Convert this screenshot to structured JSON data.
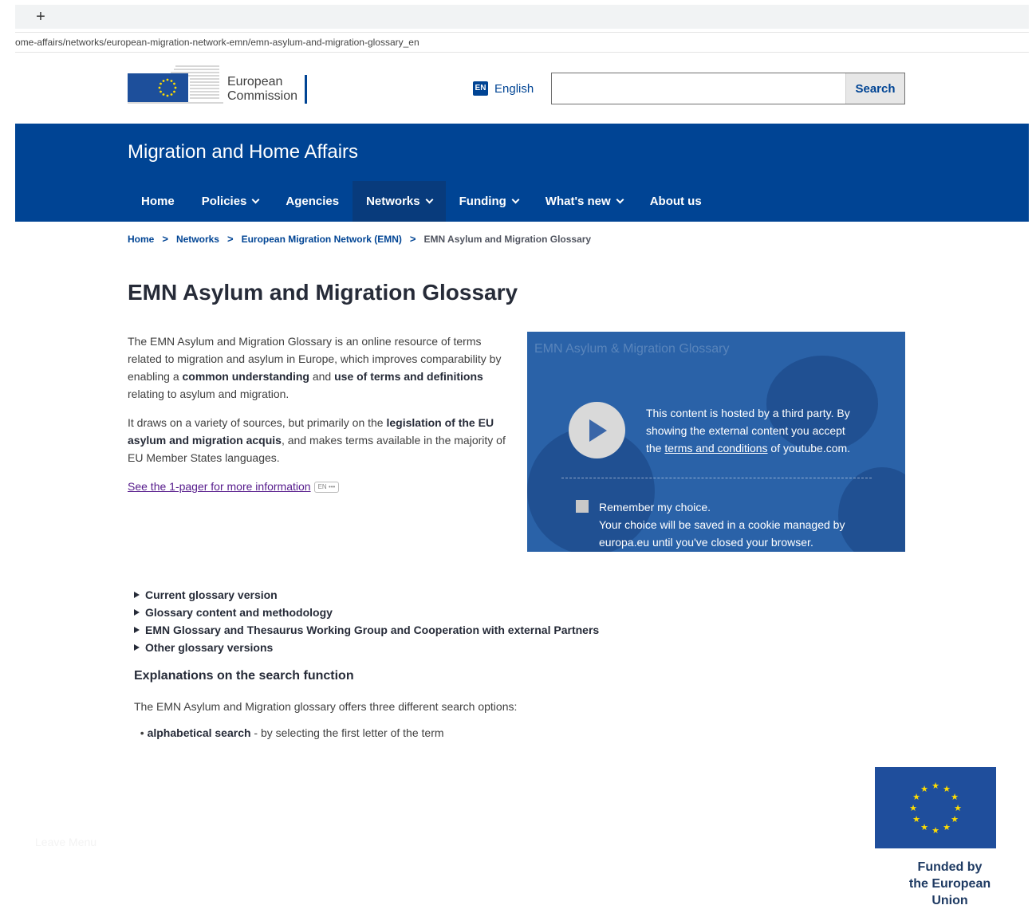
{
  "browser": {
    "newtab_label": "+",
    "url": "ome-affairs/networks/european-migration-network-emn/emn-asylum-and-migration-glossary_en"
  },
  "header": {
    "logo_line1": "European",
    "logo_line2": "Commission",
    "language_badge": "EN",
    "language_label": "English",
    "search_placeholder": "",
    "search_button": "Search"
  },
  "site": {
    "title": "Migration and Home Affairs",
    "nav": [
      {
        "label": "Home",
        "dropdown": false
      },
      {
        "label": "Policies",
        "dropdown": true
      },
      {
        "label": "Agencies",
        "dropdown": false
      },
      {
        "label": "Networks",
        "dropdown": true,
        "active": true
      },
      {
        "label": "Funding",
        "dropdown": true
      },
      {
        "label": "What's new",
        "dropdown": true
      },
      {
        "label": "About us",
        "dropdown": false
      }
    ],
    "accent_color": "#004494"
  },
  "breadcrumb": {
    "items": [
      "Home",
      "Networks",
      "European Migration Network (EMN)"
    ],
    "current": "EMN Asylum and Migration Glossary",
    "separator": ">"
  },
  "page": {
    "title": "EMN Asylum and Migration Glossary",
    "intro1_a": "The EMN Asylum and Migration Glossary is an online resource of terms related to migration and asylum in Europe, which improves comparability by enabling a ",
    "intro1_b": "common understanding",
    "intro1_c": " and ",
    "intro1_d": "use of terms and definitions",
    "intro1_e": " relating to asylum and migration.",
    "intro2_a": "It draws on a variety of sources, but primarily on the ",
    "intro2_b": "legislation of the EU asylum and migration acquis",
    "intro2_c": ", and makes terms available in the majority of EU Member States languages.",
    "pager_link": "See the 1-pager for more information",
    "pager_badge_lang": "EN",
    "pager_badge_more": "•••"
  },
  "video": {
    "background_title": "EMN Asylum & Migration Glossary",
    "notice_a": "This content is hosted by a third party. By showing the external content you accept the ",
    "notice_link": "terms and conditions",
    "notice_b": " of youtube.com.",
    "remember_title": "Remember my choice.",
    "remember_text": "Your choice will be saved in a cookie managed by europa.eu until you've closed your browser."
  },
  "details": [
    "Current glossary version",
    "Glossary content and methodology",
    "EMN Glossary and Thesaurus Working Group and Cooperation with external Partners",
    "Other glossary versions"
  ],
  "search_section": {
    "heading": "Explanations on the search function",
    "intro": "The EMN Asylum and Migration glossary offers three different search options:",
    "first_bullet_bold": "alphabetical search",
    "first_bullet_rest": " - by selecting the first letter of the term"
  },
  "footer": {
    "faint_text": "Leave Menu",
    "funded_line1": "Funded by",
    "funded_line2": "the European Union"
  }
}
